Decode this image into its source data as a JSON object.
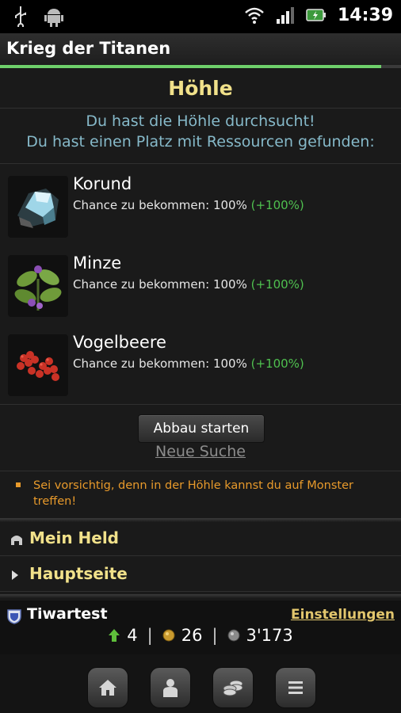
{
  "status_bar": {
    "time": "14:39",
    "icons": [
      "usb-icon",
      "android-icon",
      "wifi-icon",
      "signal-icon",
      "battery-icon"
    ]
  },
  "app": {
    "title": "Krieg der Titanen"
  },
  "page": {
    "title": "Höhle",
    "message": [
      "Du hast die Höhle durchsucht!",
      "Du hast einen Platz mit Ressourcen gefunden:"
    ]
  },
  "resources": [
    {
      "name": "Korund",
      "chance_label": "Chance zu bekommen:",
      "chance": "100%",
      "bonus": "(+100%)",
      "icon": "corundum-ore-icon"
    },
    {
      "name": "Minze",
      "chance_label": "Chance zu bekommen:",
      "chance": "100%",
      "bonus": "(+100%)",
      "icon": "mint-leaves-icon"
    },
    {
      "name": "Vogelbeere",
      "chance_label": "Chance zu bekommen:",
      "chance": "100%",
      "bonus": "(+100%)",
      "icon": "rowan-berries-icon"
    }
  ],
  "actions": {
    "start_label": "Abbau starten",
    "new_search_label": "Neue Suche"
  },
  "warning": {
    "text": "Sei vorsichtig, denn in der Höhle kannst du auf Monster treffen!"
  },
  "nav": [
    {
      "label": "Mein Held",
      "icon": "hero-helmet-icon"
    },
    {
      "label": "Hauptseite",
      "icon": "arrow-right-icon"
    }
  ],
  "player": {
    "name": "Tiwartest",
    "settings_label": "Einstellungen",
    "level": "4",
    "gold": "26",
    "silver": "3'173"
  },
  "bottom_nav": [
    "home-icon",
    "hero-icon",
    "coins-icon",
    "list-icon"
  ],
  "colors": {
    "title": "#f1e18a",
    "message": "#86b9c9",
    "bonus": "#4fc04f",
    "warning": "#e89a2b",
    "link": "#e2c66d"
  }
}
